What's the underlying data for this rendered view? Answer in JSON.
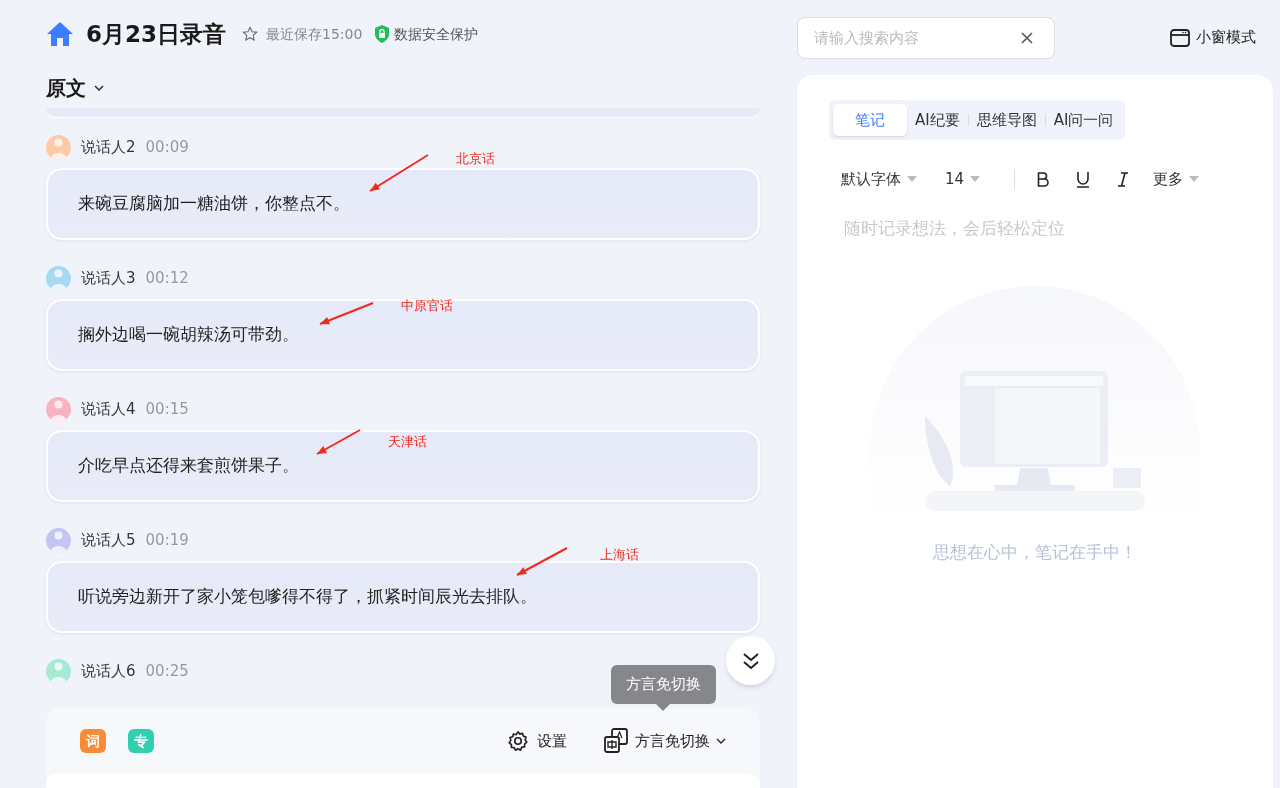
{
  "header": {
    "title": "6月23日录音",
    "starred": false,
    "saved": "最近保存15:00",
    "security": "数据安全保护"
  },
  "transcript": {
    "view": "原文",
    "entries": [
      {
        "speaker": "说话人2",
        "time": "00:09",
        "color": "#fdc9a8",
        "text": "来碗豆腐脑加一糖油饼，你整点不。",
        "annotation": "北京话"
      },
      {
        "speaker": "说话人3",
        "time": "00:12",
        "color": "#a9d8f5",
        "text": "搁外边喝一碗胡辣汤可带劲。",
        "annotation": "中原官话"
      },
      {
        "speaker": "说话人4",
        "time": "00:15",
        "color": "#f9b3c0",
        "text": "介吃早点还得来套煎饼果子。",
        "annotation": "天津话"
      },
      {
        "speaker": "说话人5",
        "time": "00:19",
        "color": "#c3c5f5",
        "text": "听说旁边新开了家小笼包嗲得不得了，抓紧时间辰光去排队。",
        "annotation": "上海话"
      },
      {
        "speaker": "说话人6",
        "time": "00:25",
        "color": "#a6ead3"
      }
    ]
  },
  "bottom_bar": {
    "badges": [
      {
        "label": "词",
        "color": "#f98a36"
      },
      {
        "label": "专",
        "color": "#2fcfb0"
      }
    ],
    "settings": "设置",
    "dialect": "方言免切换",
    "tooltip": "方言免切换"
  },
  "search": {
    "placeholder": "请输入搜索内容"
  },
  "mini_window": "小窗模式",
  "notes": {
    "tabs": [
      {
        "label": "笔记",
        "selected": true
      },
      {
        "label": "AI纪要",
        "selected": false
      },
      {
        "label": "思维导图",
        "selected": false
      },
      {
        "label": "AI问一问",
        "selected": false
      }
    ],
    "font": "默认字体",
    "size": "14",
    "more": "更多",
    "placeholder": "随时记录想法，会后轻松定位",
    "empty_message": "思想在心中，笔记在手中！"
  }
}
